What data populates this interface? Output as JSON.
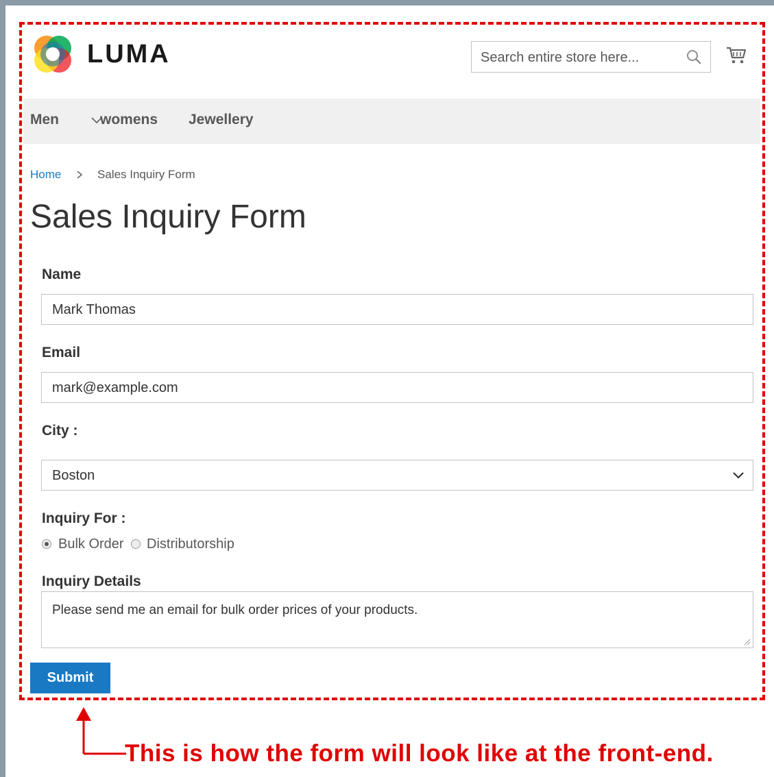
{
  "header": {
    "brand": "LUMA",
    "search": {
      "placeholder": "Search entire store here..."
    }
  },
  "nav": {
    "items": [
      {
        "label": "Men"
      },
      {
        "label": "womens"
      },
      {
        "label": "Jewellery"
      }
    ]
  },
  "breadcrumb": {
    "home": "Home",
    "current": "Sales Inquiry Form"
  },
  "page": {
    "title": "Sales Inquiry Form"
  },
  "form": {
    "name": {
      "label": "Name",
      "value": "Mark Thomas"
    },
    "email": {
      "label": "Email",
      "value": "mark@example.com"
    },
    "city": {
      "label": "City :",
      "value": "Boston"
    },
    "inquiry_for": {
      "label": "Inquiry For :",
      "options": [
        {
          "label": "Bulk Order",
          "checked": true
        },
        {
          "label": "Distributorship",
          "checked": false
        }
      ]
    },
    "details": {
      "label": "Inquiry Details",
      "value": "Please send me an email for bulk order prices of your products."
    },
    "submit_label": "Submit"
  },
  "annotation": {
    "caption": "This is how the form will look like at the front-end.",
    "color": "#e00000"
  },
  "colors": {
    "accent": "#1979c3",
    "nav_background": "#f0f0f0"
  },
  "icons": [
    "luma-logo-icon",
    "search-icon",
    "cart-icon",
    "chevron-down-icon",
    "chevron-right-icon",
    "arrow-up-icon"
  ]
}
